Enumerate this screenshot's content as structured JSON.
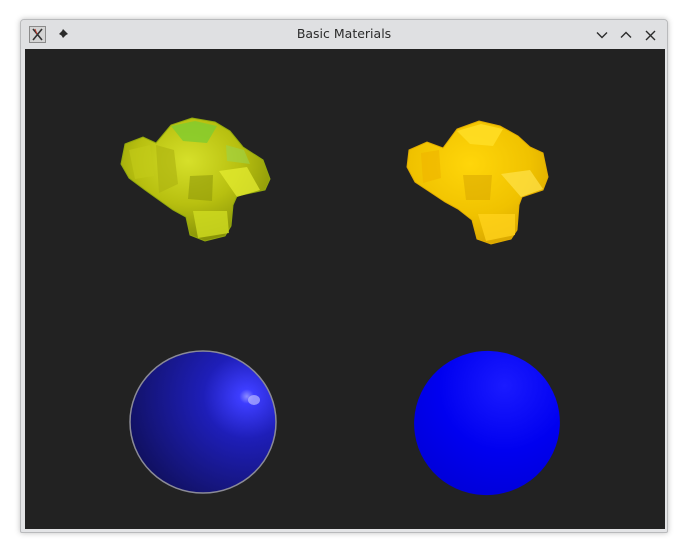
{
  "window": {
    "title": "Basic Materials"
  },
  "icons": {
    "app": "app-x-icon",
    "pin": "pin-icon",
    "minimize": "chevron-down-icon",
    "maximize": "chevron-up-icon",
    "close": "close-icon"
  },
  "scene": {
    "background": "#222222",
    "objects": [
      {
        "name": "monkey-top-left",
        "shape": "suzanne",
        "color": "#c4cc16"
      },
      {
        "name": "monkey-top-right",
        "shape": "suzanne",
        "color": "#f0c400"
      },
      {
        "name": "sphere-bottom-left",
        "shape": "sphere",
        "color": "#1c1ca8"
      },
      {
        "name": "sphere-bottom-right",
        "shape": "sphere",
        "color": "#0000ee"
      }
    ]
  }
}
